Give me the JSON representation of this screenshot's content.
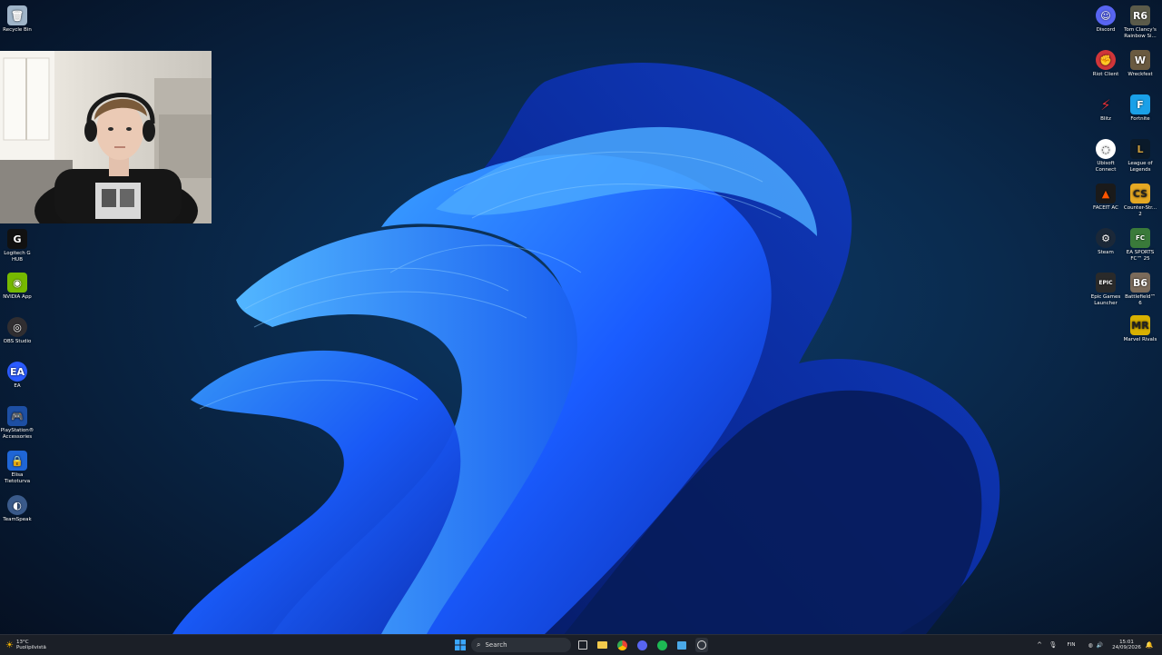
{
  "desktop": {
    "left_icons": [
      {
        "label": "Recycle Bin",
        "icon": "recycle-bin-icon",
        "color": "#9fb4c8"
      },
      {
        "label": "Logitech G HUB",
        "icon": "logitech-g-icon",
        "color": "#111111"
      },
      {
        "label": "NVIDIA App",
        "icon": "nvidia-icon",
        "color": "#76b900"
      },
      {
        "label": "OBS Studio",
        "icon": "obs-icon",
        "color": "#302e31"
      },
      {
        "label": "EA",
        "icon": "ea-icon",
        "color": "#2b5bff"
      },
      {
        "label": "PlayStation® Accessories",
        "icon": "playstation-icon",
        "color": "#1d4fa3"
      },
      {
        "label": "Elisa Tietoturva",
        "icon": "shield-lock-icon",
        "color": "#1f66d6"
      },
      {
        "label": "TeamSpeak",
        "icon": "teamspeak-icon",
        "color": "#3a5a8a"
      }
    ],
    "right_icons_col1": [
      {
        "label": "Discord",
        "icon": "discord-icon",
        "color": "#5865f2"
      },
      {
        "label": "Riot Client",
        "icon": "riot-icon",
        "color": "#d13639"
      },
      {
        "label": "Blitz",
        "icon": "blitz-icon",
        "color": "#e0303a"
      },
      {
        "label": "Ubisoft Connect",
        "icon": "ubisoft-icon",
        "color": "#ffffff"
      },
      {
        "label": "FACEIT AC",
        "icon": "faceit-icon",
        "color": "#ff5500"
      },
      {
        "label": "Steam",
        "icon": "steam-icon",
        "color": "#1b2838"
      },
      {
        "label": "Epic Games Launcher",
        "icon": "epic-games-icon",
        "color": "#2a2a2a"
      }
    ],
    "right_icons_col2": [
      {
        "label": "Tom Clancy's Rainbow Si...",
        "icon": "rainbow-six-icon",
        "color": "#5b5b4a"
      },
      {
        "label": "Wreckfest",
        "icon": "wreckfest-icon",
        "color": "#6a5a40"
      },
      {
        "label": "Fortnite",
        "icon": "fortnite-icon",
        "color": "#1aa0e8"
      },
      {
        "label": "League of Legends",
        "icon": "league-icon",
        "color": "#c89b3c"
      },
      {
        "label": "Counter-Str... 2",
        "icon": "counter-strike-icon",
        "color": "#e5a823"
      },
      {
        "label": "EA SPORTS FC™ 25",
        "icon": "ea-fc-icon",
        "color": "#3a7a3a"
      },
      {
        "label": "Battlefield™ 6",
        "icon": "battlefield-icon",
        "color": "#7a6a5a"
      },
      {
        "label": "Marvel Rivals",
        "icon": "marvel-rivals-icon",
        "color": "#d9b100"
      }
    ]
  },
  "taskbar": {
    "weather_temp": "13°C",
    "weather_desc": "Puolipilvistä",
    "search_placeholder": "Search",
    "language": "FIN",
    "time": "15:01",
    "date": "24/09/2026"
  },
  "colors": {
    "taskbar_bg": "#1b1f27",
    "accent": "#0078d4"
  }
}
